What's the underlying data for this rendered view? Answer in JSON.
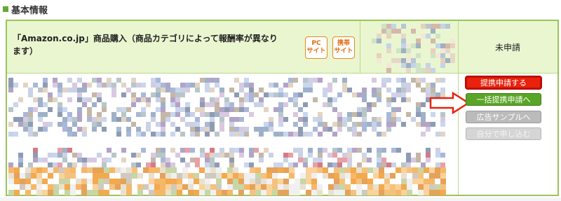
{
  "section": {
    "title": "基本情報"
  },
  "product": {
    "name": "「Amazon.co.jp」商品購入（商品カテゴリによって報酬率が異なります）",
    "pc_badge": "PC\nサイト",
    "mobile_badge": "携帯\nサイト"
  },
  "status": {
    "label": "未申請"
  },
  "buttons": {
    "apply": "提携申請する",
    "bulk_apply": "一括提携申請へ",
    "ad_sample": "広告サンプルへ",
    "self_apply": "自分で申し込む"
  },
  "icons": {
    "arrow": "right-arrow-icon"
  },
  "colors": {
    "accent": "#66a835",
    "header_bg": "#eaf6d0",
    "highlight": "#e8220d"
  }
}
